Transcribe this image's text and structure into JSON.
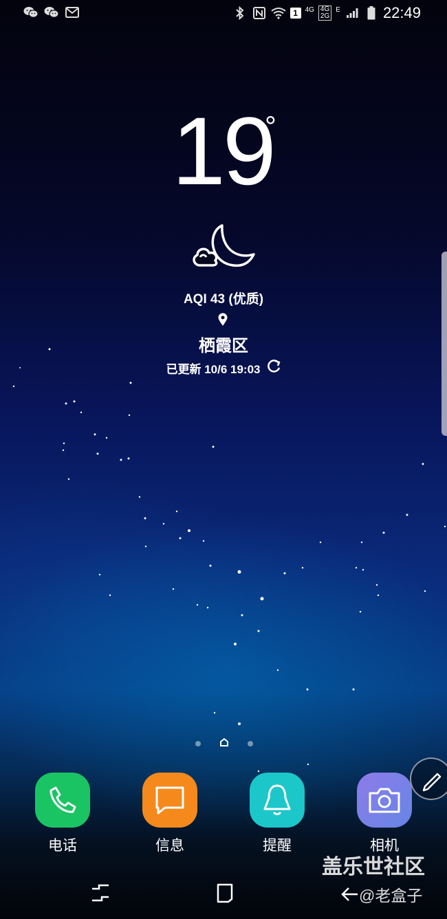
{
  "status_bar": {
    "left_icons": [
      "wechat-icon",
      "wechat-icon",
      "mail-icon"
    ],
    "right_icons": [
      "bluetooth-icon",
      "nfc-icon",
      "wifi-icon",
      "sim1-badge",
      "4g-label",
      "4g-2g-label",
      "e-label",
      "signal-icon",
      "battery-icon"
    ],
    "sim_badge": "1",
    "net1": "4G",
    "net2a": "4G",
    "net2b": "2G",
    "net3": "E",
    "time": "22:49"
  },
  "weather": {
    "temperature": "19",
    "degree": "°",
    "condition_icon": "moon-cloud-icon",
    "aqi": "AQI 43 (优质)",
    "location": "栖霞区",
    "updated": "已更新 10/6 19:03",
    "refresh_icon": "refresh-icon"
  },
  "page_indicator": {
    "pages": 3,
    "current": 2
  },
  "dock": [
    {
      "label": "电话",
      "icon": "phone-icon",
      "color": "#1bc463"
    },
    {
      "label": "信息",
      "icon": "message-icon",
      "color": "#f5891c"
    },
    {
      "label": "提醒",
      "icon": "bell-icon",
      "color": "#1cc7c9"
    },
    {
      "label": "相机",
      "icon": "camera-icon",
      "color": "#7b7de6"
    }
  ],
  "navigation": [
    "recent-apps-icon",
    "home-icon",
    "back-icon"
  ],
  "watermark": {
    "line1": "盖乐世社区",
    "line2": "@老盒子"
  }
}
